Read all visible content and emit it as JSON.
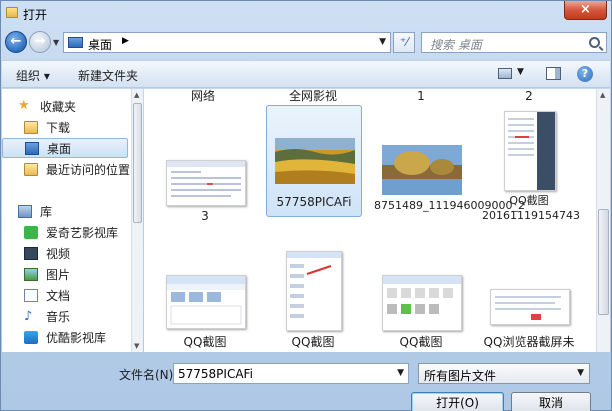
{
  "window": {
    "title": "打开",
    "close_glyph": "×"
  },
  "nav": {
    "back_glyph": "←",
    "forward_glyph": "→",
    "address": "桌面",
    "address_arrow": "▶",
    "dropdown_glyph": "▼",
    "refresh_glyph": "⁺⁄",
    "search_placeholder": "搜索 桌面"
  },
  "toolbar": {
    "organize": "组织 ▾",
    "new_folder": "新建文件夹",
    "view_drop": "▼",
    "help": "?"
  },
  "sidebar": {
    "items": [
      {
        "label": "收藏夹",
        "icon": "star-icon"
      },
      {
        "label": "下载",
        "icon": "folder-icon"
      },
      {
        "label": "桌面",
        "icon": "desktop-icon",
        "selected": true
      },
      {
        "label": "最近访问的位置",
        "icon": "recent-icon"
      },
      {
        "label": "库",
        "icon": "library-icon"
      },
      {
        "label": "爱奇艺影视库",
        "icon": "iqiyi-icon"
      },
      {
        "label": "视频",
        "icon": "video-icon"
      },
      {
        "label": "图片",
        "icon": "picture-icon"
      },
      {
        "label": "文档",
        "icon": "document-icon"
      },
      {
        "label": "音乐",
        "icon": "music-icon"
      },
      {
        "label": "优酷影视库",
        "icon": "youku-icon"
      }
    ]
  },
  "files": {
    "top_row": [
      "网络",
      "全网影视",
      "1",
      "2"
    ],
    "tiles": [
      {
        "label": "3"
      },
      {
        "label": "57758PICAFi",
        "selected": true
      },
      {
        "label": "8751489_111946009000_2"
      },
      {
        "label": "QQ截图20161119154743"
      },
      {
        "label": "QQ截图"
      },
      {
        "label": "QQ截图"
      },
      {
        "label": "QQ截图"
      },
      {
        "label": "QQ浏览器截屏未"
      }
    ]
  },
  "bottom": {
    "filename_label": "文件名(N):",
    "filename_value": "57758PICAFi",
    "filetype_value": "所有图片文件",
    "open_button": "打开(O)",
    "cancel_button": "取消"
  }
}
